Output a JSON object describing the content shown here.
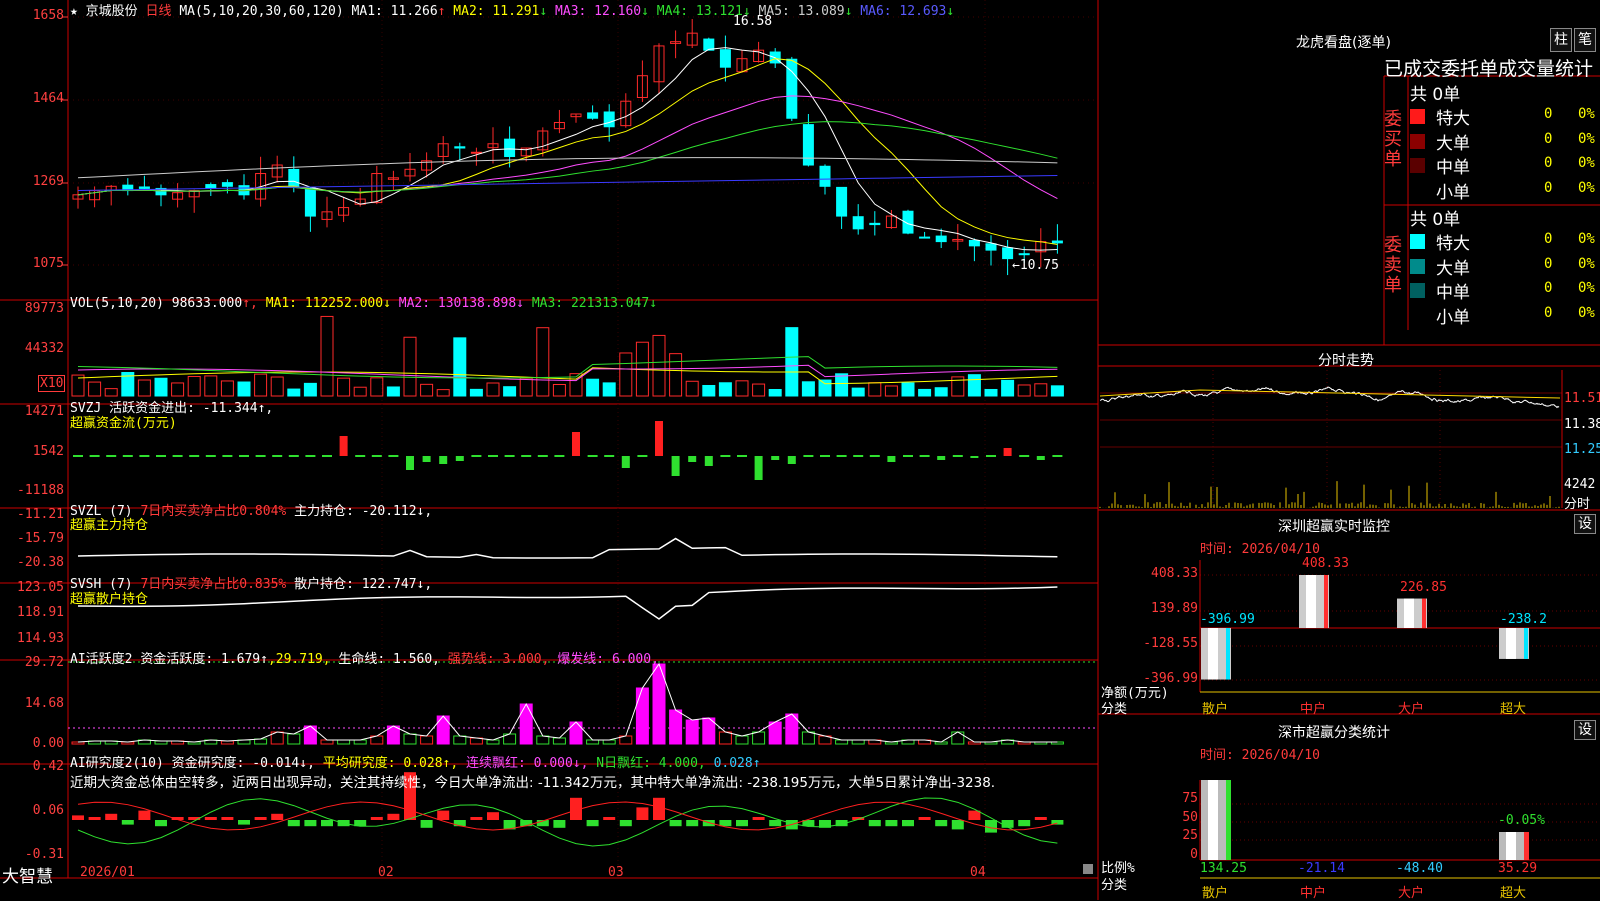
{
  "header": {
    "stock_name": "京城股份",
    "period": "日线",
    "ma_label": "MA(5,10,20,30,60,120)",
    "ma_values": [
      {
        "label": "MA1: 11.266",
        "arrow": "↑",
        "color": "#ffffff"
      },
      {
        "label": "MA2: 11.291",
        "arrow": "↓",
        "color": "#ffff00"
      },
      {
        "label": "MA3: 12.160",
        "arrow": "↓",
        "color": "#ff4dff"
      },
      {
        "label": "MA4: 13.121",
        "arrow": "↓",
        "color": "#2fe02f"
      },
      {
        "label": "MA5: 13.089",
        "arrow": "↓",
        "color": "#cccccc"
      },
      {
        "label": "MA6: 12.693",
        "arrow": "↓",
        "color": "#5a5aff"
      }
    ],
    "high_label": "16.58",
    "low_label": "←10.75"
  },
  "price_axis": [
    "1658",
    "1464",
    "1269",
    "1075"
  ],
  "vol": {
    "title": "VOL(5,10,20)",
    "value": "98633.000",
    "ma1": "MA1: 112252.000↓",
    "ma2": "MA2: 130138.898↓",
    "ma3": "MA3: 221313.047↓",
    "axis": [
      "89773",
      "44332"
    ],
    "unit": "X10"
  },
  "svzj": {
    "title": "SVZJ  活跃资金进出: -11.344↑,",
    "sub": "超赢资金流(万元)",
    "axis": [
      "14271",
      "1542",
      "-11188"
    ]
  },
  "svzl": {
    "title": "SVZL (7)",
    "ratio": "7日内买卖净占比0.804%",
    "hold": "主力持仓: -20.112↓,",
    "sub": "超赢主力持仓",
    "axis": [
      "-11.21",
      "-15.79",
      "-20.38"
    ]
  },
  "svsh": {
    "title": "SVSH (7)",
    "ratio": "7日内买卖净占比0.835%",
    "hold": "散户持仓: 122.747↓,",
    "sub": "超赢散户持仓",
    "axis": [
      "123.05",
      "118.91",
      "114.93"
    ]
  },
  "ai_active": {
    "title": "AI活跃度2",
    "v1": "资金活跃度: 1.679↑",
    "v2": ",29.719,",
    "v3": "生命线: 1.560,",
    "v4": "强势线: 3.000,",
    "v5": "爆发线: 6.000,",
    "axis": [
      "29.72",
      "14.68",
      "0.00"
    ]
  },
  "ai_research": {
    "title": "AI研究度2(10)",
    "v1": "资金研究度: -0.014↓,",
    "v2": "平均研究度: 0.028↑,",
    "v3": "连续飘红: 0.000↓,",
    "v4": "N日飘红: 4.000,",
    "v5": "0.028↑",
    "note": "近期大资金总体由空转多，近两日出现异动，关注其持续性，今日大单净流出: -11.342万元，其中特大单净流出: -238.195万元，大单5日累计净出-3238.",
    "axis": [
      "0.42",
      "0.06",
      "-0.31"
    ]
  },
  "x_axis": {
    "brand": "大智慧",
    "labels": [
      "2026/01",
      "02",
      "03",
      "04"
    ]
  },
  "right": {
    "longhu_title": "龙虎看盘(逐单)",
    "btn_zhu": "柱",
    "btn_bi": "笔",
    "stats_title": "已成交委托单成交量统计",
    "buy_group": "委买单",
    "sell_group": "委卖单",
    "buy_total": "共 0单",
    "sell_total": "共 0单",
    "buy_rows": [
      {
        "name": "特大",
        "val": "0",
        "pct": "0%",
        "color": "#ff1a1a"
      },
      {
        "name": "大单",
        "val": "0",
        "pct": "0%",
        "color": "#8b0000"
      },
      {
        "name": "中单",
        "val": "0",
        "pct": "0%",
        "color": "#5a0000"
      },
      {
        "name": "小单",
        "val": "0",
        "pct": "0%",
        "color": ""
      }
    ],
    "sell_rows": [
      {
        "name": "特大",
        "val": "0",
        "pct": "0%",
        "color": "#00ffff"
      },
      {
        "name": "大单",
        "val": "0",
        "pct": "0%",
        "color": "#008b8b"
      },
      {
        "name": "中单",
        "val": "0",
        "pct": "0%",
        "color": "#006060"
      },
      {
        "name": "小单",
        "val": "0",
        "pct": "0%",
        "color": ""
      }
    ],
    "intraday_title": "分时走势",
    "intraday_axis": [
      "11.51",
      "11.38",
      "11.25"
    ],
    "intraday_vol": "4242",
    "intraday_unit": "分时",
    "monitor_title": "深圳超赢实时监控",
    "setting": "设",
    "monitor_time": "时间: 2026/04/10",
    "monitor_axis": [
      "408.33",
      "139.89",
      "-128.55",
      "-396.99"
    ],
    "monitor_values": [
      {
        "cat": "散户",
        "value": -396.99,
        "label": "-396.99"
      },
      {
        "cat": "中户",
        "value": 408.33,
        "label": "408.33"
      },
      {
        "cat": "大户",
        "value": 226.85,
        "label": "226.85"
      },
      {
        "cat": "超大",
        "value": -238.2,
        "label": "-238.2"
      }
    ],
    "monitor_ylabel": "净额(万元)",
    "monitor_xlabel": "分类",
    "class_title": "深市超赢分类统计",
    "class_time": "时间: 2026/04/10",
    "class_axis": [
      "75",
      "50",
      "25",
      "0"
    ],
    "class_values": [
      {
        "cat": "散户",
        "pct": 100,
        "label": "134.25"
      },
      {
        "cat": "中户",
        "pct": 0,
        "label": "-21.14"
      },
      {
        "cat": "大户",
        "pct": 0,
        "label": "-48.40"
      },
      {
        "cat": "超大",
        "pct": 35,
        "label": "35.29"
      }
    ],
    "class_pct_label": "-0.05%",
    "class_ylabel": "比例%",
    "class_xlabel": "分类"
  }
}
